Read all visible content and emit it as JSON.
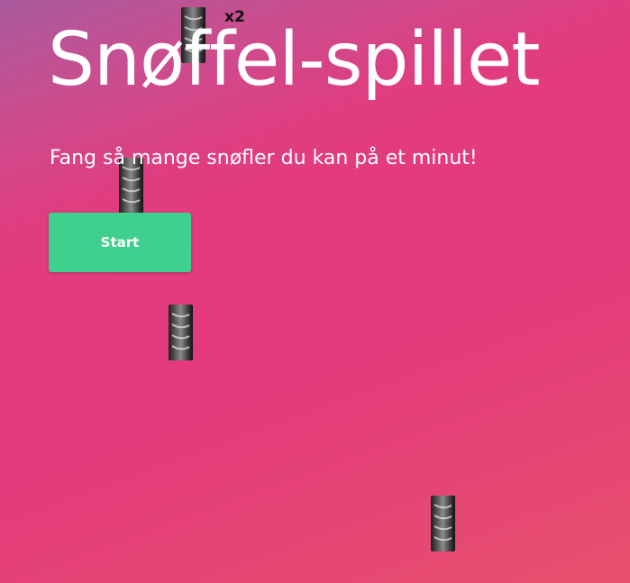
{
  "game": {
    "title": "Snøffel-spillet",
    "subtitle": "Fang så mange snøfler du kan på et minut!",
    "start_label": "Start",
    "multiplier_label": "x2"
  },
  "colors": {
    "background_start": "#a95b9e",
    "background_mid": "#e43a7c",
    "background_end": "#e6506d",
    "start_button": "#3fcf8e",
    "text": "#ffffff"
  },
  "falling_items": [
    {
      "name": "snoffel",
      "icon": "snoffel-sprite"
    },
    {
      "name": "snoffel",
      "icon": "snoffel-sprite"
    },
    {
      "name": "snoffel",
      "icon": "snoffel-sprite"
    },
    {
      "name": "snoffel",
      "icon": "snoffel-sprite"
    }
  ]
}
